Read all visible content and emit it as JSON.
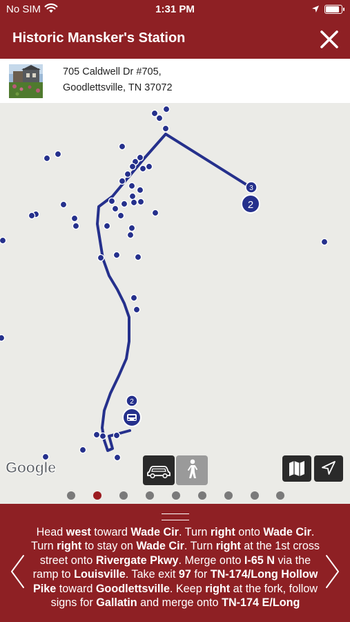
{
  "status": {
    "carrier": "No SIM",
    "time": "1:31 PM"
  },
  "header": {
    "title": "Historic Mansker's Station"
  },
  "address": {
    "line1": "705 Caldwell Dr #705,",
    "line2": "Goodlettsville, TN 37072"
  },
  "map": {
    "attribution": "Google",
    "markers": {
      "start_badge": "2",
      "end_badge_top": "3",
      "end_badge_main": "2"
    }
  },
  "pager": {
    "count": 9,
    "active_index": 1
  },
  "directions": {
    "step": [
      {
        "t": "Head ",
        "b": false
      },
      {
        "t": "west",
        "b": true
      },
      {
        "t": " toward ",
        "b": false
      },
      {
        "t": "Wade Cir",
        "b": true
      },
      {
        "t": ". Turn ",
        "b": false
      },
      {
        "t": "right",
        "b": true
      },
      {
        "t": " onto ",
        "b": false
      },
      {
        "t": "Wade Cir",
        "b": true
      },
      {
        "t": ". Turn ",
        "b": false
      },
      {
        "t": "right",
        "b": true
      },
      {
        "t": " to stay on ",
        "b": false
      },
      {
        "t": "Wade Cir",
        "b": true
      },
      {
        "t": ". Turn ",
        "b": false
      },
      {
        "t": "right",
        "b": true
      },
      {
        "t": " at the 1st cross street onto ",
        "b": false
      },
      {
        "t": "Rivergate Pkwy",
        "b": true
      },
      {
        "t": ". Merge onto ",
        "b": false
      },
      {
        "t": "I-65 N",
        "b": true
      },
      {
        "t": " via the ramp to ",
        "b": false
      },
      {
        "t": "Louisville",
        "b": true
      },
      {
        "t": ". Take exit ",
        "b": false
      },
      {
        "t": "97",
        "b": true
      },
      {
        "t": " for ",
        "b": false
      },
      {
        "t": "TN-174/Long Hollow Pike",
        "b": true
      },
      {
        "t": " toward ",
        "b": false
      },
      {
        "t": "Goodlettsville",
        "b": true
      },
      {
        "t": ". Keep ",
        "b": false
      },
      {
        "t": "right",
        "b": true
      },
      {
        "t": " at the fork, follow signs for ",
        "b": false
      },
      {
        "t": "Gallatin",
        "b": true
      },
      {
        "t": " and merge onto ",
        "b": false
      },
      {
        "t": "TN-174 E/Long",
        "b": true
      }
    ]
  }
}
